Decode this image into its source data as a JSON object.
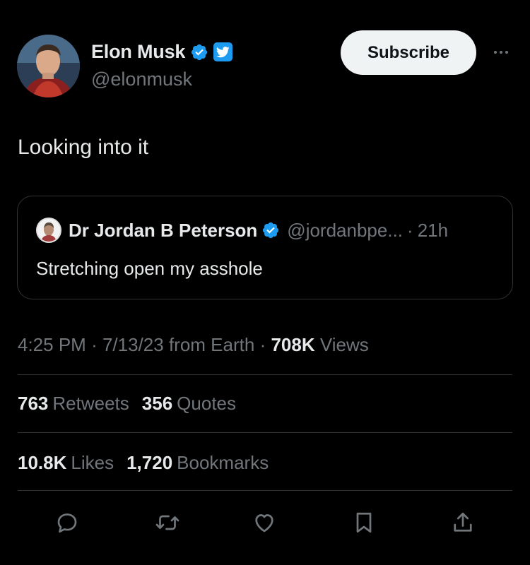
{
  "author": {
    "name": "Elon Musk",
    "handle": "@elonmusk",
    "avatar_icon": "profile-photo"
  },
  "subscribe_label": "Subscribe",
  "tweet_text": "Looking into it",
  "quote": {
    "name": "Dr Jordan B Peterson",
    "handle": "@jordanbpe...",
    "separator": "·",
    "time": "21h",
    "text": "Stretching open my asshole"
  },
  "meta": {
    "time": "4:25 PM",
    "sep": "·",
    "date": "7/13/23",
    "source": "from Earth",
    "views_count": "708K",
    "views_label": "Views"
  },
  "stats": {
    "retweets_count": "763",
    "retweets_label": "Retweets",
    "quotes_count": "356",
    "quotes_label": "Quotes",
    "likes_count": "10.8K",
    "likes_label": "Likes",
    "bookmarks_count": "1,720",
    "bookmarks_label": "Bookmarks"
  },
  "colors": {
    "background": "#000000",
    "text": "#e7e9ea",
    "muted": "#71767b",
    "accent": "#1d9bf0",
    "border": "#2f3336"
  },
  "actions": [
    "reply-icon",
    "retweet-icon",
    "like-icon",
    "bookmark-icon",
    "share-icon"
  ]
}
